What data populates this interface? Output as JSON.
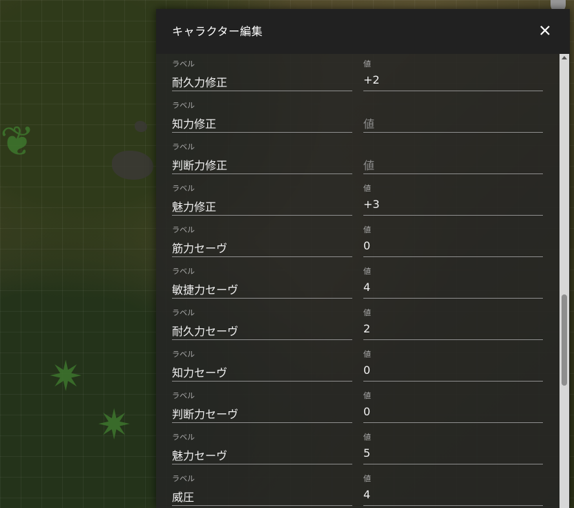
{
  "dialog": {
    "title": "キャラクター編集",
    "close_icon": "close-icon"
  },
  "fields": [
    {
      "label_caption": "ラベル",
      "label": "耐久力修正",
      "value_caption": "値",
      "value": "+2",
      "value_placeholder": ""
    },
    {
      "label_caption": "ラベル",
      "label": "知力修正",
      "value_caption": "",
      "value": "",
      "value_placeholder": "値"
    },
    {
      "label_caption": "ラベル",
      "label": "判断力修正",
      "value_caption": "",
      "value": "",
      "value_placeholder": "値"
    },
    {
      "label_caption": "ラベル",
      "label": "魅力修正",
      "value_caption": "値",
      "value": "+3",
      "value_placeholder": ""
    },
    {
      "label_caption": "ラベル",
      "label": "筋力セーヴ",
      "value_caption": "値",
      "value": "0",
      "value_placeholder": ""
    },
    {
      "label_caption": "ラベル",
      "label": "敏捷力セーヴ",
      "value_caption": "値",
      "value": "4",
      "value_placeholder": ""
    },
    {
      "label_caption": "ラベル",
      "label": "耐久力セーヴ",
      "value_caption": "値",
      "value": "2",
      "value_placeholder": ""
    },
    {
      "label_caption": "ラベル",
      "label": "知力セーヴ",
      "value_caption": "値",
      "value": "0",
      "value_placeholder": ""
    },
    {
      "label_caption": "ラベル",
      "label": "判断力セーヴ",
      "value_caption": "値",
      "value": "0",
      "value_placeholder": ""
    },
    {
      "label_caption": "ラベル",
      "label": "魅力セーヴ",
      "value_caption": "値",
      "value": "5",
      "value_placeholder": ""
    },
    {
      "label_caption": "ラベル",
      "label": "威圧",
      "value_caption": "値",
      "value": "4",
      "value_placeholder": ""
    }
  ],
  "scrollbar": {
    "position_fraction": 0.55
  }
}
